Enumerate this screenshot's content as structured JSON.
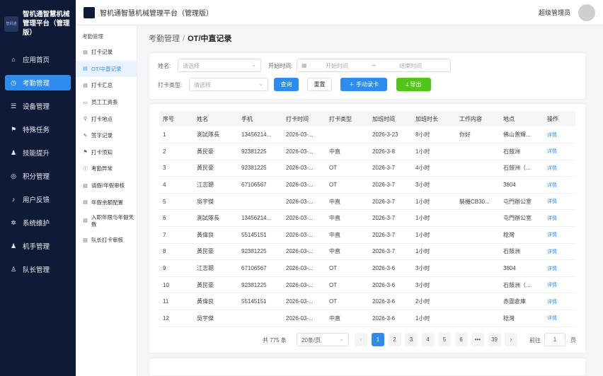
{
  "brand": {
    "logo_text": "智机通",
    "title_line1": "智机通智慧机械",
    "title_line2": "管理平台（管理版）"
  },
  "menu": [
    {
      "label": "应用首页",
      "icon": "home-icon",
      "glyph": "⌂"
    },
    {
      "label": "考勤管理",
      "icon": "clock-icon",
      "glyph": "◷"
    },
    {
      "label": "设备管理",
      "icon": "sliders-icon",
      "glyph": "☰"
    },
    {
      "label": "特殊任务",
      "icon": "flag-icon",
      "glyph": "⚑"
    },
    {
      "label": "技能提升",
      "icon": "user-icon",
      "glyph": "♟"
    },
    {
      "label": "积分管理",
      "icon": "database-icon",
      "glyph": "◎"
    },
    {
      "label": "用户反馈",
      "icon": "bell-icon",
      "glyph": "♪"
    },
    {
      "label": "系统维护",
      "icon": "gear-icon",
      "glyph": "✲"
    },
    {
      "label": "机手管理",
      "icon": "user-icon",
      "glyph": "♟"
    },
    {
      "label": "队长管理",
      "icon": "user-outline-icon",
      "glyph": "♙"
    }
  ],
  "header": {
    "title": "智机通智慧机械管理平台（管理版）",
    "user": "超级管理员"
  },
  "submenu": {
    "title": "考勤管理",
    "items": [
      {
        "label": "打卡记录",
        "icon": "list-icon",
        "glyph": "▤"
      },
      {
        "label": "OT/中直记录",
        "icon": "list-icon",
        "glyph": "▤"
      },
      {
        "label": "打卡汇总",
        "icon": "list-icon",
        "glyph": "▤"
      },
      {
        "label": "员工工资条",
        "icon": "card-icon",
        "glyph": "▭"
      },
      {
        "label": "打卡地点",
        "icon": "location-icon",
        "glyph": "⚲"
      },
      {
        "label": "签字记录",
        "icon": "pen-icon",
        "glyph": "✎"
      },
      {
        "label": "打卡须知",
        "icon": "flag-icon",
        "glyph": "⚑"
      },
      {
        "label": "考勤异常",
        "icon": "info-icon",
        "glyph": "ⓘ"
      },
      {
        "label": "请假/年假审核",
        "icon": "doc-icon",
        "glyph": "▤"
      },
      {
        "label": "年假余额配置",
        "icon": "doc-icon",
        "glyph": "▤"
      },
      {
        "label": "入职年限与年假天数",
        "icon": "doc-icon",
        "glyph": "▤"
      },
      {
        "label": "队长打卡审核",
        "icon": "clipboard-icon",
        "glyph": "▤"
      }
    ]
  },
  "breadcrumb": {
    "parent": "考勤管理",
    "sep": "/",
    "current": "OT/中直记录"
  },
  "filters": {
    "name_label": "姓名:",
    "name_placeholder": "请选择",
    "start_label": "开始时间:",
    "start_placeholder": "开始时间",
    "range_sep": "–",
    "end_placeholder": "结束时间",
    "type_label": "打卡类型:",
    "type_placeholder": "请选择",
    "search": "查询",
    "reset": "重置",
    "add": "手动录卡",
    "export": "导出"
  },
  "table": {
    "columns": [
      "序号",
      "姓名",
      "手机",
      "打卡时间",
      "打卡类型",
      "加班时间",
      "加班时长",
      "工作内容",
      "地点",
      "操作"
    ],
    "rows": [
      [
        "1",
        "測試隊長",
        "13456214...",
        "2026-03-...",
        "",
        "2026-3-23",
        "8小时",
        "你好",
        "佛山普輝...",
        "详情"
      ],
      [
        "2",
        "黃民豪",
        "92381225",
        "2026-03-...",
        "中直",
        "2026-3-8",
        "1小时",
        "",
        "石鼓洲",
        "详情"
      ],
      [
        "3",
        "黃民豪",
        "92381225",
        "2026-03-...",
        "OT",
        "2026-3-7",
        "4小时",
        "",
        "石鼓洲（...",
        "详情"
      ],
      [
        "4",
        "江志聰",
        "67106567",
        "2026-03-...",
        "OT",
        "2026-3-7",
        "3小时",
        "",
        "3804",
        "详情"
      ],
      [
        "5",
        "吳宇傑",
        "",
        "2026-03-...",
        "中直",
        "2026-3-7",
        "1小时",
        "裝機CB30...",
        "屯門辦公室",
        "详情"
      ],
      [
        "6",
        "測試隊長",
        "13456214...",
        "2026-03-...",
        "中直",
        "2026-3-7",
        "1小时",
        "",
        "屯門辦公室",
        "详情"
      ],
      [
        "7",
        "黃偉良",
        "55145151",
        "2026-03-...",
        "中直",
        "2026-3-7",
        "1小时",
        "",
        "稔灣",
        "详情"
      ],
      [
        "8",
        "黃民豪",
        "92381225",
        "2026-03-...",
        "中直",
        "2026-3-7",
        "1小时",
        "",
        "石鼓洲",
        "详情"
      ],
      [
        "9",
        "江志聰",
        "67106567",
        "2026-03-...",
        "OT",
        "2026-3-6",
        "3小时",
        "",
        "3804",
        "详情"
      ],
      [
        "10",
        "黃民豪",
        "92381225",
        "2026-03-...",
        "OT",
        "2026-3-6",
        "3小时",
        "",
        "石鼓洲（...",
        "详情"
      ],
      [
        "11",
        "黃偉良",
        "55145151",
        "2026-03-...",
        "OT",
        "2026-3-6",
        "2小时",
        "",
        "赤圍倉庫",
        "详情"
      ],
      [
        "12",
        "吳宇傑",
        "",
        "2026-03-...",
        "中直",
        "2026-3-6",
        "1小时",
        "",
        "稔灣",
        "详情"
      ]
    ]
  },
  "pagination": {
    "total": "共 775 条",
    "page_size": "20条/页",
    "prev": "‹",
    "next": "›",
    "pages": [
      "1",
      "2",
      "3",
      "4",
      "5",
      "6",
      "•••",
      "39"
    ],
    "goto_label": "前往",
    "goto_value": "1",
    "page_suffix": "页"
  },
  "colors": {
    "primary": "#2d8cf0",
    "success": "#52c41a",
    "sidebar": "#0f1a36"
  }
}
